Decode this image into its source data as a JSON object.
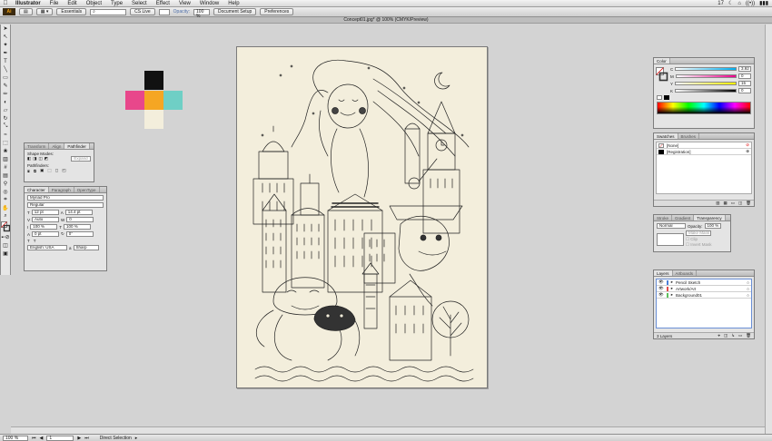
{
  "menubar": {
    "app": "Illustrator",
    "items": [
      "File",
      "Edit",
      "Object",
      "Type",
      "Select",
      "Effect",
      "View",
      "Window",
      "Help"
    ],
    "status": [
      "17",
      "☾",
      "⌂",
      "((•))",
      "▮▮▮"
    ]
  },
  "controlbar": {
    "workspace": "Essentials",
    "search_placeholder": "",
    "cslive": "CS Live",
    "opacity_label": "Opacity:",
    "opacity_value": "100 %",
    "document_setup": "Document Setup",
    "preferences": "Preferences"
  },
  "document": {
    "title": "Concept01.jpg* @ 100% (CMYK/Preview)"
  },
  "colors": {
    "artboard": "#f3eedc",
    "swatch_black": "#111111",
    "swatch_pink": "#e8478b",
    "swatch_orange": "#f5a623",
    "swatch_teal": "#6fcfc5",
    "swatch_cream": "#f3eedc"
  },
  "pathfinder_panel": {
    "tabs": [
      "Transform",
      "Align",
      "Pathfinder"
    ],
    "shape_modes_label": "Shape Modes:",
    "expand_label": "Expand",
    "pathfinders_label": "Pathfinders:"
  },
  "character_panel": {
    "tabs": [
      "Character",
      "Paragraph",
      "OpenType"
    ],
    "font_family": "Myriad Pro",
    "font_style": "Regular",
    "font_size": "12 pt",
    "leading": "14.4 pt",
    "kerning": "Auto",
    "tracking": "0",
    "vscale": "100 %",
    "hscale": "100 %",
    "baseline": "0 pt",
    "rotation": "0°",
    "language": "English: USA",
    "antialias": "Sharp"
  },
  "color_panel": {
    "tabs": [
      "Color"
    ],
    "channels": [
      {
        "label": "C",
        "value": "3.92",
        "gradient": "linear-gradient(90deg,#fff,#00aeef)"
      },
      {
        "label": "M",
        "value": "0",
        "gradient": "linear-gradient(90deg,#fff,#ec008c)"
      },
      {
        "label": "Y",
        "value": "15",
        "gradient": "linear-gradient(90deg,#fff,#fff200)"
      },
      {
        "label": "K",
        "value": "0",
        "gradient": "linear-gradient(90deg,#fff,#000)"
      }
    ]
  },
  "swatches_panel": {
    "tabs": [
      "Swatches",
      "Brushes"
    ],
    "items": [
      "[None]",
      "[Registration]"
    ]
  },
  "transparency_panel": {
    "tabs": [
      "Stroke",
      "Gradient",
      "Transparency"
    ],
    "mode": "Normal",
    "opacity_label": "Opacity:",
    "opacity_value": "100 %",
    "make_mask": "Make Mask",
    "clip": "Clip",
    "invert_mask": "Invert Mask"
  },
  "layers_panel": {
    "tabs": [
      "Layers",
      "Artboards"
    ],
    "layers": [
      {
        "name": "Pencil Sketch",
        "color": "#4c7fd8"
      },
      {
        "name": "Artwork/Art",
        "color": "#e14a4a"
      },
      {
        "name": "Background01",
        "color": "#5cbf5c"
      }
    ],
    "count": "3 Layers"
  },
  "statusbar": {
    "zoom": "100 %",
    "artboard_num": "1",
    "status": "Direct Selection"
  }
}
